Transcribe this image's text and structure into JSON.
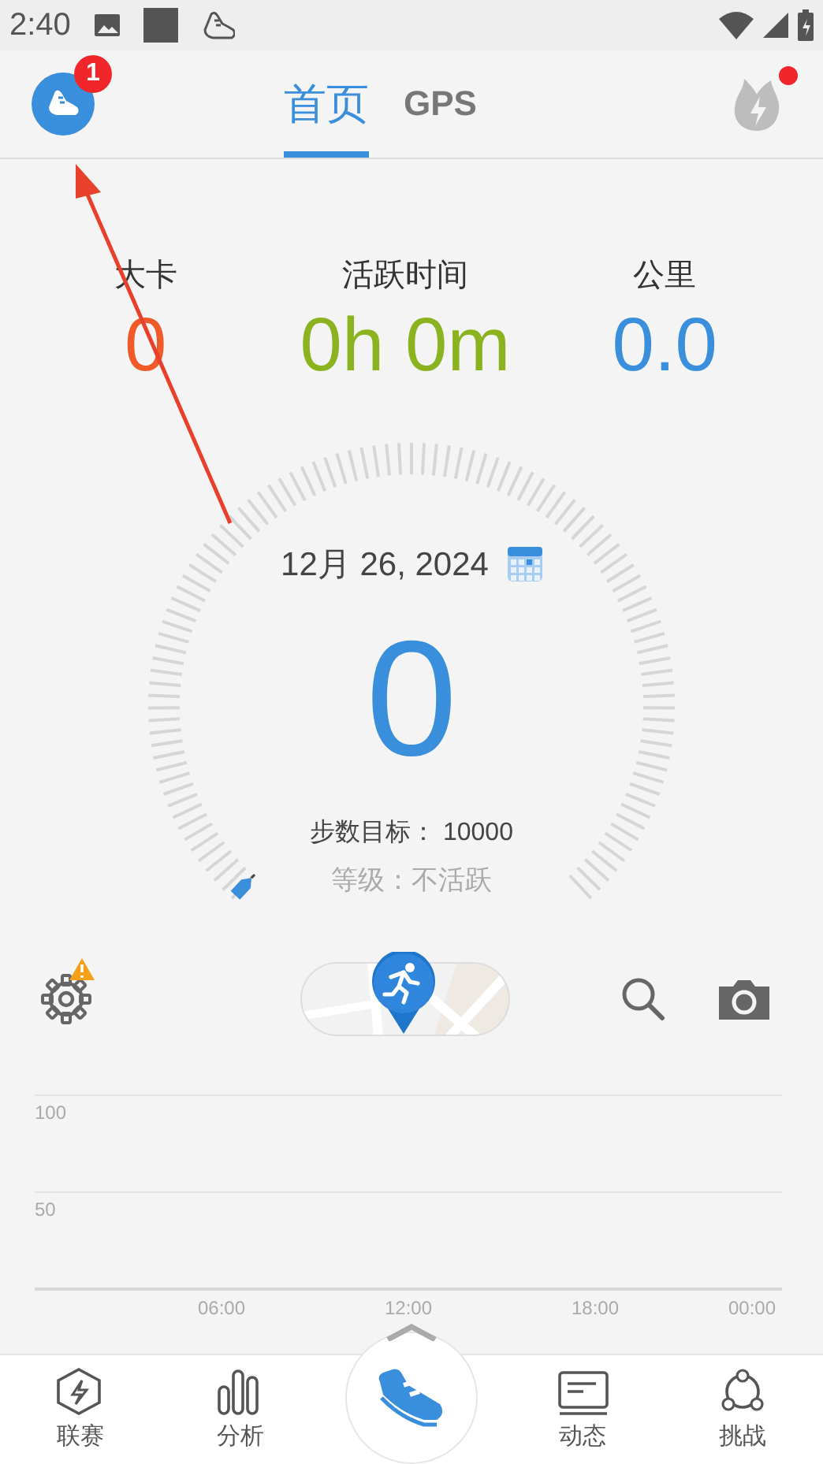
{
  "status_bar": {
    "time": "2:40"
  },
  "header": {
    "badge": "1",
    "notification_dot": true,
    "tabs": [
      {
        "label": "首页",
        "selected": true
      },
      {
        "label": "GPS",
        "selected": false
      }
    ]
  },
  "stats": [
    {
      "label": "大卡",
      "value": "0",
      "color": "#f05a28"
    },
    {
      "label": "活跃时间",
      "value": "0h 0m",
      "color": "#8ab31f"
    },
    {
      "label": "公里",
      "value": "0.0",
      "color": "#3a8fdc"
    }
  ],
  "dial": {
    "date": "12月 26, 2024",
    "steps": "0",
    "goal": "步数目标： 10000",
    "grade": "等级：不活跃"
  },
  "toolbar": {
    "settings_warning": true
  },
  "chart": {
    "chart_data": {
      "type": "bar",
      "xlim": [
        0,
        24
      ],
      "ylim": [
        0,
        100
      ],
      "yticks": [
        50,
        100
      ],
      "xticks": [
        {
          "value": 6,
          "label": "06:00"
        },
        {
          "value": 12,
          "label": "12:00"
        },
        {
          "value": 18,
          "label": "18:00"
        },
        {
          "value": 24,
          "label": "00:00"
        }
      ]
    }
  },
  "bottom_nav": [
    {
      "kind": "league",
      "label": "联赛"
    },
    {
      "kind": "analysis",
      "label": "分析"
    },
    {
      "kind": "center"
    },
    {
      "kind": "feed",
      "label": "动态"
    },
    {
      "kind": "challenge",
      "label": "挑战"
    }
  ]
}
